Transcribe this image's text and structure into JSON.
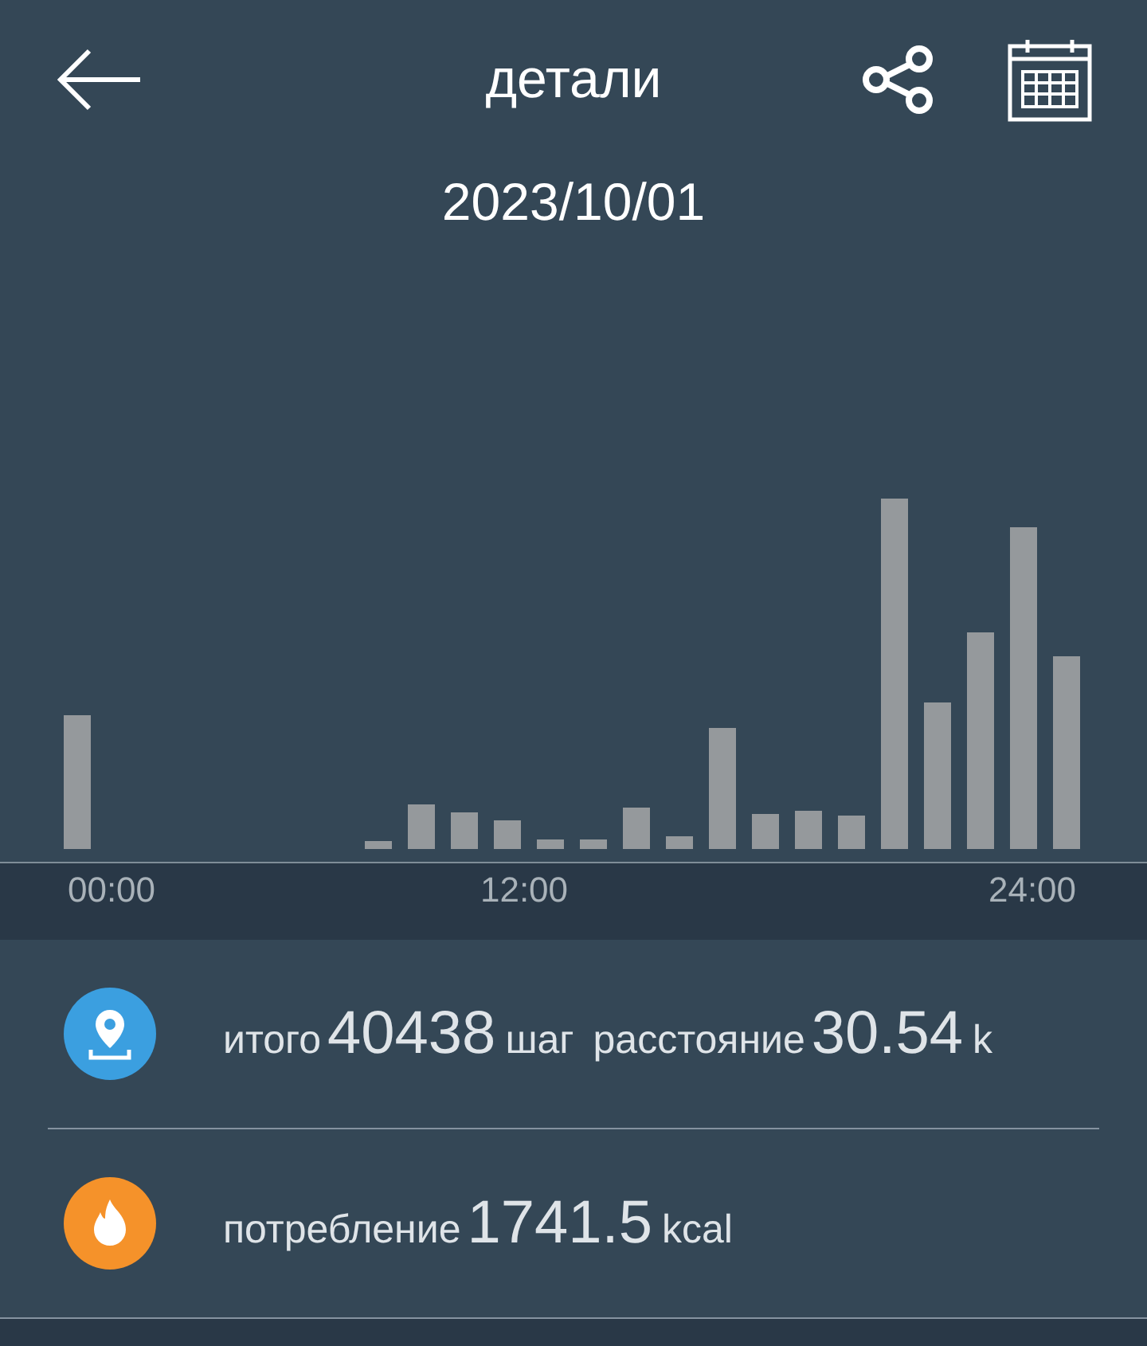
{
  "header": {
    "title": "детали"
  },
  "date": "2023/10/01",
  "chart": {
    "x_labels": [
      "00:00",
      "12:00",
      "24:00"
    ]
  },
  "stats": [
    {
      "kind": "steps",
      "items": [
        {
          "label": "итого",
          "value": "40438",
          "unit": "шаг"
        },
        {
          "label": "расстояние",
          "value": "30.54",
          "unit": "k"
        }
      ]
    },
    {
      "kind": "calories",
      "items": [
        {
          "label": "потребление",
          "value": "1741.5",
          "unit": "kcal"
        }
      ]
    }
  ]
}
